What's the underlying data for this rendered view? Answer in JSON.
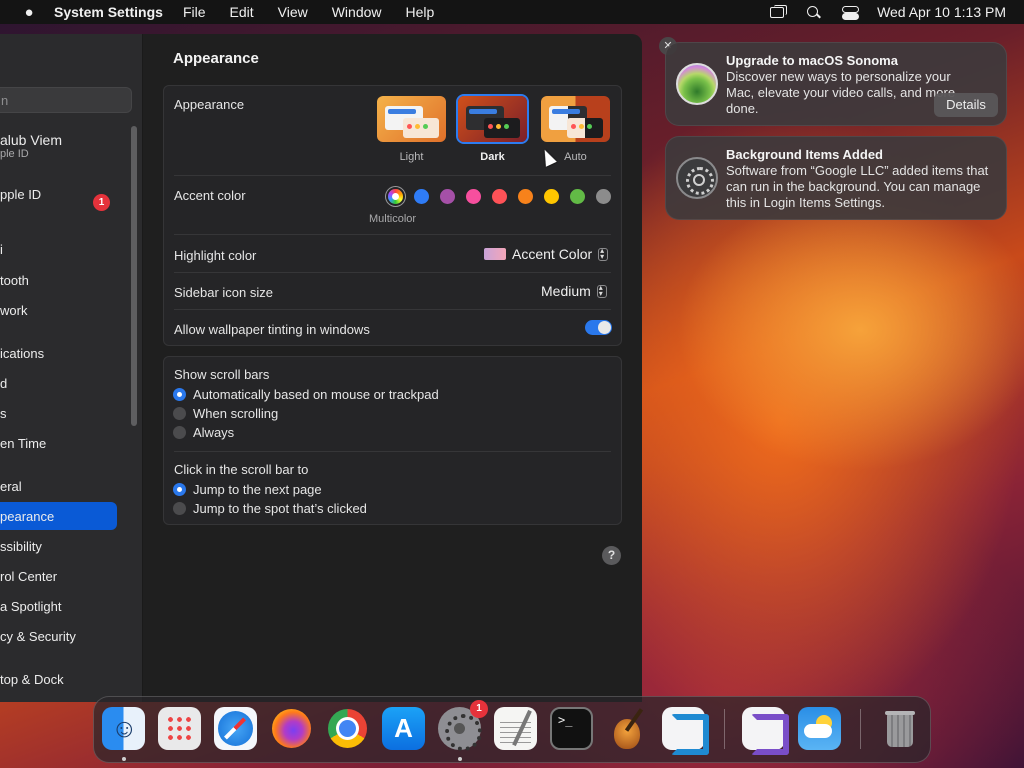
{
  "menubar": {
    "app_name": "System Settings",
    "menus": [
      "File",
      "Edit",
      "View",
      "Window",
      "Help"
    ],
    "datetime": "Wed Apr 10  1:13 PM"
  },
  "sidebar": {
    "search_placeholder": "n",
    "profile_name": "alub Viem",
    "profile_sub": "ple ID",
    "apple_id": "pple ID",
    "apple_id_badge": "1",
    "items": [
      "i",
      "tooth",
      "work",
      "ications",
      "d",
      "s",
      "en Time",
      "eral",
      "pearance",
      "ssibility",
      "rol Center",
      "a Spotlight",
      "cy & Security",
      "top & Dock"
    ],
    "selected_index": 8
  },
  "main": {
    "title": "Appearance",
    "appearance": {
      "label": "Appearance",
      "options": [
        "Light",
        "Dark",
        "Auto"
      ],
      "selected": "Dark"
    },
    "accent": {
      "label": "Accent color",
      "colors": [
        "multicolor",
        "#2f7cf6",
        "#a550a7",
        "#f74f9e",
        "#ff5257",
        "#f7821b",
        "#ffc600",
        "#62ba46",
        "#8c8c8c"
      ],
      "caption": "Multicolor"
    },
    "highlight": {
      "label": "Highlight color",
      "value": "Accent Color"
    },
    "sidebar_icon": {
      "label": "Sidebar icon size",
      "value": "Medium"
    },
    "tinting": {
      "label": "Allow wallpaper tinting in windows",
      "enabled": true
    },
    "scroll_bars": {
      "label": "Show scroll bars",
      "options": [
        "Automatically based on mouse or trackpad",
        "When scrolling",
        "Always"
      ],
      "selected_index": 0
    },
    "click_scroll": {
      "label": "Click in the scroll bar to",
      "options": [
        "Jump to the next page",
        "Jump to the spot that’s clicked"
      ],
      "selected_index": 0
    },
    "help": "?"
  },
  "notifications": [
    {
      "title": "Upgrade to macOS Sonoma",
      "body": "Discover new ways to personalize your Mac, elevate your video calls, and more done.",
      "action": "Details",
      "icon": "sonoma-icon"
    },
    {
      "title": "Background Items Added",
      "body": "Software from “Google LLC” added items that can run in the background. You can manage this in Login Items Settings.",
      "icon": "settings-gear-icon"
    }
  ],
  "dock": {
    "apps": [
      "finder",
      "launchpad",
      "safari",
      "firefox",
      "chrome",
      "app-store",
      "system-settings",
      "textedit",
      "terminal",
      "garageband",
      "vscode",
      "visual-studio",
      "weather",
      "trash"
    ],
    "system_settings_badge": "1"
  },
  "colors": {
    "accent": "#2a78ec",
    "window_bg": "#1f1f1f",
    "sidebar_bg": "#2b2b2d",
    "selection": "#0a5ad6"
  }
}
